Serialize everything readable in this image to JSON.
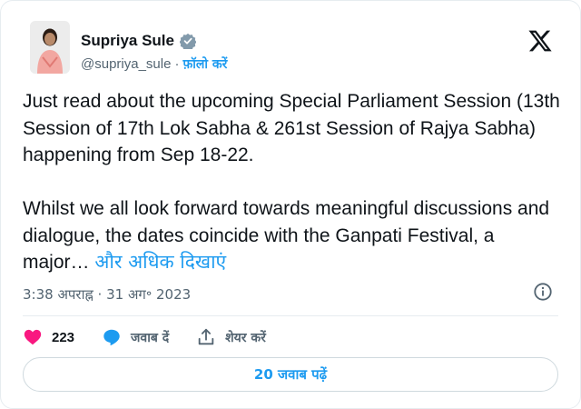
{
  "author": {
    "display_name": "Supriya Sule",
    "handle": "@supriya_sule",
    "separator": "·",
    "follow_label": "फ़ॉलो करें",
    "verified_icon": "verified-badge-icon",
    "avatar_icon": "avatar"
  },
  "tweet": {
    "body": "Just read about the upcoming Special Parliament Session (13th Session of 17th Lok Sabha & 261st Session of Rajya Sabha) happening from Sep 18-22.\n\nWhilst we all look forward towards meaningful discussions and dialogue, the dates coincide with the Ganpati Festival, a major… ",
    "show_more": "और अधिक दिखाएं",
    "timestamp": "3:38 अपराह्न · 31 अग॰ 2023"
  },
  "actions": {
    "like_count": "223",
    "reply_label": "जवाब दें",
    "share_label": "शेयर करें"
  },
  "replies_button": "20 जवाब पढ़ें",
  "colors": {
    "accent": "#1d9bf0",
    "like": "#f91880",
    "text": "#0f1419",
    "muted": "#536471"
  }
}
